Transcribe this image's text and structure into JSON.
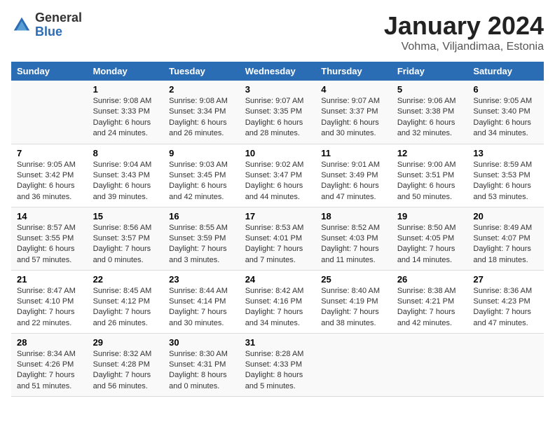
{
  "logo": {
    "general": "General",
    "blue": "Blue"
  },
  "title": "January 2024",
  "subtitle": "Vohma, Viljandimaa, Estonia",
  "weekdays": [
    "Sunday",
    "Monday",
    "Tuesday",
    "Wednesday",
    "Thursday",
    "Friday",
    "Saturday"
  ],
  "weeks": [
    [
      {
        "day": "",
        "sunrise": "",
        "sunset": "",
        "daylight": ""
      },
      {
        "day": "1",
        "sunrise": "Sunrise: 9:08 AM",
        "sunset": "Sunset: 3:33 PM",
        "daylight": "Daylight: 6 hours and 24 minutes."
      },
      {
        "day": "2",
        "sunrise": "Sunrise: 9:08 AM",
        "sunset": "Sunset: 3:34 PM",
        "daylight": "Daylight: 6 hours and 26 minutes."
      },
      {
        "day": "3",
        "sunrise": "Sunrise: 9:07 AM",
        "sunset": "Sunset: 3:35 PM",
        "daylight": "Daylight: 6 hours and 28 minutes."
      },
      {
        "day": "4",
        "sunrise": "Sunrise: 9:07 AM",
        "sunset": "Sunset: 3:37 PM",
        "daylight": "Daylight: 6 hours and 30 minutes."
      },
      {
        "day": "5",
        "sunrise": "Sunrise: 9:06 AM",
        "sunset": "Sunset: 3:38 PM",
        "daylight": "Daylight: 6 hours and 32 minutes."
      },
      {
        "day": "6",
        "sunrise": "Sunrise: 9:05 AM",
        "sunset": "Sunset: 3:40 PM",
        "daylight": "Daylight: 6 hours and 34 minutes."
      }
    ],
    [
      {
        "day": "7",
        "sunrise": "Sunrise: 9:05 AM",
        "sunset": "Sunset: 3:42 PM",
        "daylight": "Daylight: 6 hours and 36 minutes."
      },
      {
        "day": "8",
        "sunrise": "Sunrise: 9:04 AM",
        "sunset": "Sunset: 3:43 PM",
        "daylight": "Daylight: 6 hours and 39 minutes."
      },
      {
        "day": "9",
        "sunrise": "Sunrise: 9:03 AM",
        "sunset": "Sunset: 3:45 PM",
        "daylight": "Daylight: 6 hours and 42 minutes."
      },
      {
        "day": "10",
        "sunrise": "Sunrise: 9:02 AM",
        "sunset": "Sunset: 3:47 PM",
        "daylight": "Daylight: 6 hours and 44 minutes."
      },
      {
        "day": "11",
        "sunrise": "Sunrise: 9:01 AM",
        "sunset": "Sunset: 3:49 PM",
        "daylight": "Daylight: 6 hours and 47 minutes."
      },
      {
        "day": "12",
        "sunrise": "Sunrise: 9:00 AM",
        "sunset": "Sunset: 3:51 PM",
        "daylight": "Daylight: 6 hours and 50 minutes."
      },
      {
        "day": "13",
        "sunrise": "Sunrise: 8:59 AM",
        "sunset": "Sunset: 3:53 PM",
        "daylight": "Daylight: 6 hours and 53 minutes."
      }
    ],
    [
      {
        "day": "14",
        "sunrise": "Sunrise: 8:57 AM",
        "sunset": "Sunset: 3:55 PM",
        "daylight": "Daylight: 6 hours and 57 minutes."
      },
      {
        "day": "15",
        "sunrise": "Sunrise: 8:56 AM",
        "sunset": "Sunset: 3:57 PM",
        "daylight": "Daylight: 7 hours and 0 minutes."
      },
      {
        "day": "16",
        "sunrise": "Sunrise: 8:55 AM",
        "sunset": "Sunset: 3:59 PM",
        "daylight": "Daylight: 7 hours and 3 minutes."
      },
      {
        "day": "17",
        "sunrise": "Sunrise: 8:53 AM",
        "sunset": "Sunset: 4:01 PM",
        "daylight": "Daylight: 7 hours and 7 minutes."
      },
      {
        "day": "18",
        "sunrise": "Sunrise: 8:52 AM",
        "sunset": "Sunset: 4:03 PM",
        "daylight": "Daylight: 7 hours and 11 minutes."
      },
      {
        "day": "19",
        "sunrise": "Sunrise: 8:50 AM",
        "sunset": "Sunset: 4:05 PM",
        "daylight": "Daylight: 7 hours and 14 minutes."
      },
      {
        "day": "20",
        "sunrise": "Sunrise: 8:49 AM",
        "sunset": "Sunset: 4:07 PM",
        "daylight": "Daylight: 7 hours and 18 minutes."
      }
    ],
    [
      {
        "day": "21",
        "sunrise": "Sunrise: 8:47 AM",
        "sunset": "Sunset: 4:10 PM",
        "daylight": "Daylight: 7 hours and 22 minutes."
      },
      {
        "day": "22",
        "sunrise": "Sunrise: 8:45 AM",
        "sunset": "Sunset: 4:12 PM",
        "daylight": "Daylight: 7 hours and 26 minutes."
      },
      {
        "day": "23",
        "sunrise": "Sunrise: 8:44 AM",
        "sunset": "Sunset: 4:14 PM",
        "daylight": "Daylight: 7 hours and 30 minutes."
      },
      {
        "day": "24",
        "sunrise": "Sunrise: 8:42 AM",
        "sunset": "Sunset: 4:16 PM",
        "daylight": "Daylight: 7 hours and 34 minutes."
      },
      {
        "day": "25",
        "sunrise": "Sunrise: 8:40 AM",
        "sunset": "Sunset: 4:19 PM",
        "daylight": "Daylight: 7 hours and 38 minutes."
      },
      {
        "day": "26",
        "sunrise": "Sunrise: 8:38 AM",
        "sunset": "Sunset: 4:21 PM",
        "daylight": "Daylight: 7 hours and 42 minutes."
      },
      {
        "day": "27",
        "sunrise": "Sunrise: 8:36 AM",
        "sunset": "Sunset: 4:23 PM",
        "daylight": "Daylight: 7 hours and 47 minutes."
      }
    ],
    [
      {
        "day": "28",
        "sunrise": "Sunrise: 8:34 AM",
        "sunset": "Sunset: 4:26 PM",
        "daylight": "Daylight: 7 hours and 51 minutes."
      },
      {
        "day": "29",
        "sunrise": "Sunrise: 8:32 AM",
        "sunset": "Sunset: 4:28 PM",
        "daylight": "Daylight: 7 hours and 56 minutes."
      },
      {
        "day": "30",
        "sunrise": "Sunrise: 8:30 AM",
        "sunset": "Sunset: 4:31 PM",
        "daylight": "Daylight: 8 hours and 0 minutes."
      },
      {
        "day": "31",
        "sunrise": "Sunrise: 8:28 AM",
        "sunset": "Sunset: 4:33 PM",
        "daylight": "Daylight: 8 hours and 5 minutes."
      },
      {
        "day": "",
        "sunrise": "",
        "sunset": "",
        "daylight": ""
      },
      {
        "day": "",
        "sunrise": "",
        "sunset": "",
        "daylight": ""
      },
      {
        "day": "",
        "sunrise": "",
        "sunset": "",
        "daylight": ""
      }
    ]
  ]
}
